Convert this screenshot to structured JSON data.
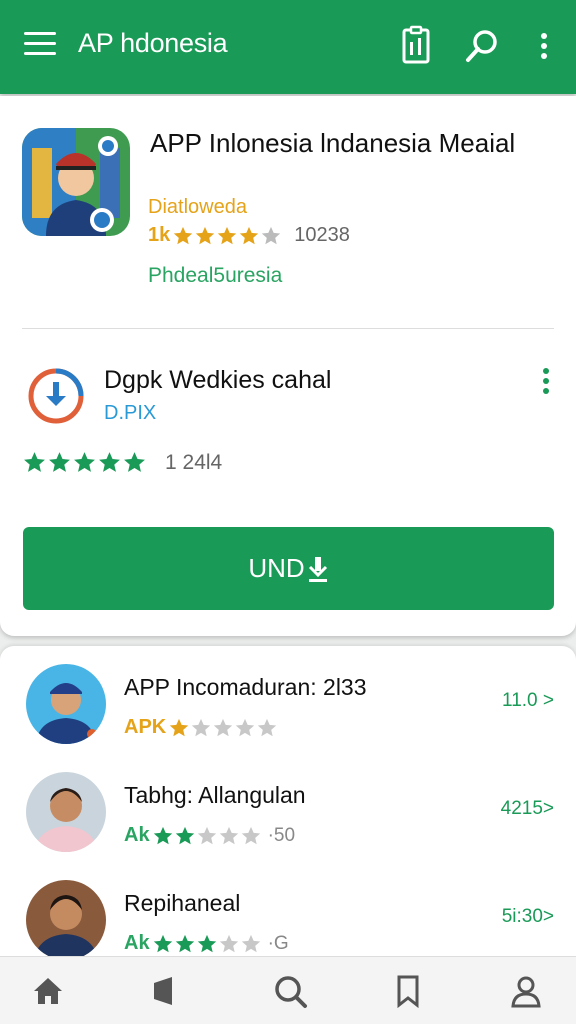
{
  "appbar": {
    "title": "AP hdonesia",
    "icons": [
      "menu-icon",
      "clipboard-icon",
      "search-icon",
      "more-vert-icon"
    ]
  },
  "featured": {
    "app_name": "APP Inlonesia lndanesia Meaial",
    "developer": "Diatloweda",
    "rating_prefix": "1k",
    "stars": 4,
    "rating_count": "10238",
    "category": "Phdeal5uresia"
  },
  "download": {
    "title": "Dgpk Wedkies cahal",
    "subtitle": "D.PIX",
    "stars": 5,
    "rating_count": "1 24l4",
    "install_label": "UND"
  },
  "list": [
    {
      "name": "APP Incomaduran: 2l33",
      "pre": "APK",
      "stars": 1,
      "extra": "",
      "right": "11.0 >"
    },
    {
      "name": "Tabhg: Allangulan",
      "pre": "Ak",
      "stars": 2,
      "extra": "·50",
      "right": "4215>"
    },
    {
      "name": "Repihaneal",
      "pre": "Ak",
      "stars": 3,
      "extra": "·G",
      "right": "5i:30>"
    }
  ],
  "bottom_nav": [
    "home-icon",
    "library-icon",
    "search-icon",
    "bookmark-icon",
    "profile-icon"
  ],
  "colors": {
    "primary": "#1a9a57",
    "accent": "#e5a31a",
    "link": "#2a9ad6"
  }
}
